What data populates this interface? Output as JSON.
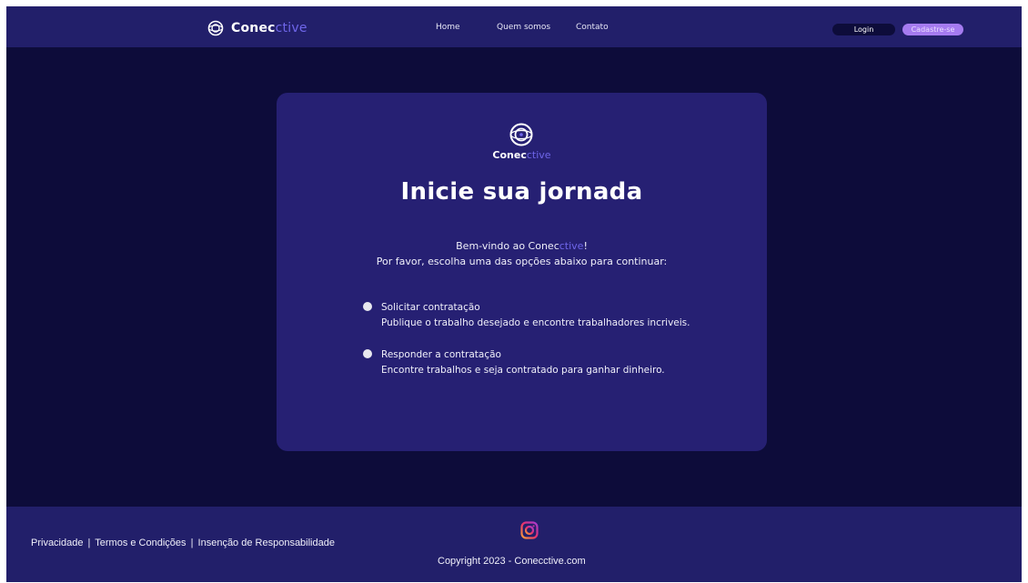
{
  "header": {
    "brand_part1": "Conec",
    "brand_part2": "ctive",
    "nav": [
      "Home",
      "Quem somos",
      "Contato"
    ],
    "login_label": "Login",
    "signup_label": "Cadastre-se"
  },
  "card": {
    "brand_part1": "Conec",
    "brand_part2": "ctive",
    "title": "Inicie sua jornada",
    "welcome_prefix": "Bem-vindo ao Conec",
    "welcome_brand": "ctive",
    "welcome_suffix": "!",
    "instruction": "Por favor, escolha uma das opções abaixo para continuar:",
    "options": [
      {
        "title": "Solicitar contratação",
        "description": "Publique o trabalho desejado e encontre trabalhadores incriveis."
      },
      {
        "title": "Responder a contratação",
        "description": "Encontre trabalhos e seja contratado para ganhar dinheiro."
      }
    ]
  },
  "footer": {
    "links": [
      "Privacidade",
      "Termos e Condições",
      "Insenção de Responsabilidade"
    ],
    "separator": "|",
    "copyright": "Copyright 2023 - Conecctive.com",
    "social_icon": "instagram-icon"
  },
  "colors": {
    "background": "#0d0c3a",
    "header_footer": "#221f6a",
    "card": "#262073",
    "accent": "#6f66ea",
    "signup_button": "#a57bf0"
  }
}
